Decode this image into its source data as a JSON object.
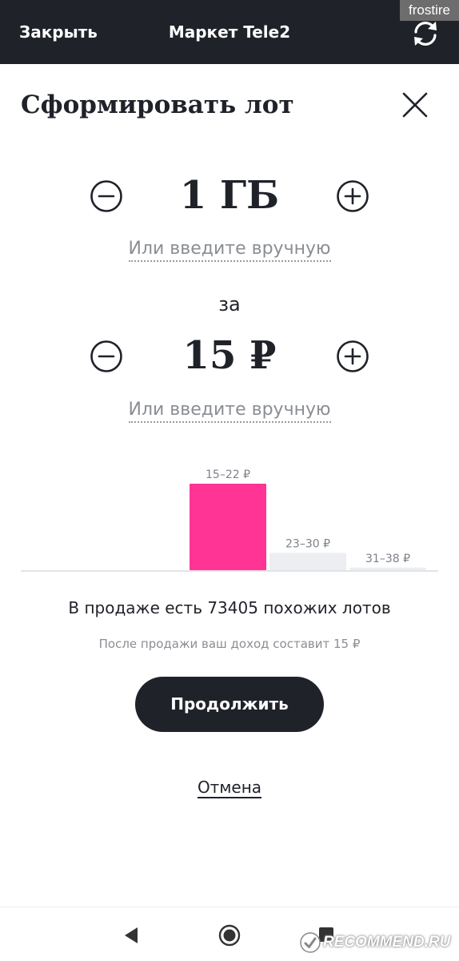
{
  "topbar": {
    "close_label": "Закрыть",
    "title": "Маркет Tele2",
    "refresh_icon": "refresh-icon",
    "watermark": "frostire"
  },
  "dialog": {
    "heading": "Сформировать лот",
    "close_icon": "close-icon"
  },
  "volume": {
    "value": "1 ГБ",
    "manual_link": "Или введите вручную"
  },
  "for_label": "за",
  "price": {
    "value": "15 ₽",
    "manual_link": "Или введите вручную"
  },
  "chart_data": {
    "type": "bar",
    "categories": [
      "15–22 ₽",
      "23–30 ₽",
      "31–38 ₽"
    ],
    "values": [
      100,
      20,
      3
    ],
    "ylim": [
      0,
      100
    ],
    "highlight_index": 0,
    "colors": {
      "highlight": "#ff3495",
      "normal": "#eceef1",
      "axis": "#d5dce3"
    },
    "grid": false,
    "legend": "none"
  },
  "info": {
    "similar_lots": "В продаже есть 73405 похожих лотов",
    "income": "После продажи ваш доход составит 15 ₽"
  },
  "actions": {
    "continue_label": "Продолжить",
    "cancel_label": "Отмена"
  },
  "navbar": {
    "back_icon": "back-triangle-icon",
    "home_icon": "home-circle-icon",
    "recent_icon": "recent-apps-icon"
  },
  "watermark_bottom": "RECOMMEND.RU",
  "colors": {
    "dark": "#1f2229",
    "accent": "#ff3495",
    "muted": "#8b8e94"
  }
}
